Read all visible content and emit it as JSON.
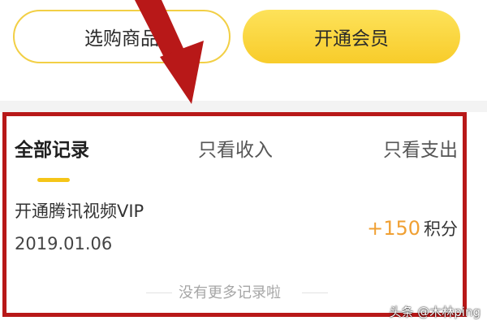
{
  "actions": {
    "shop_label": "选购商品",
    "vip_label": "开通会员"
  },
  "tabs": [
    {
      "label": "全部记录",
      "active": true
    },
    {
      "label": "只看收入",
      "active": false
    },
    {
      "label": "只看支出",
      "active": false
    }
  ],
  "records": [
    {
      "title": "开通腾讯视频VIP",
      "date": "2019.01.06",
      "amount": "+150",
      "unit": "积分"
    }
  ],
  "end_message": "没有更多记录啦",
  "watermark": "头条 @木林ping",
  "colors": {
    "accent_yellow": "#f5c518",
    "amount_orange": "#f0a033",
    "highlight_red": "#b81818"
  },
  "icons": {
    "overlay_arrow": "arrow-down-right-icon"
  }
}
